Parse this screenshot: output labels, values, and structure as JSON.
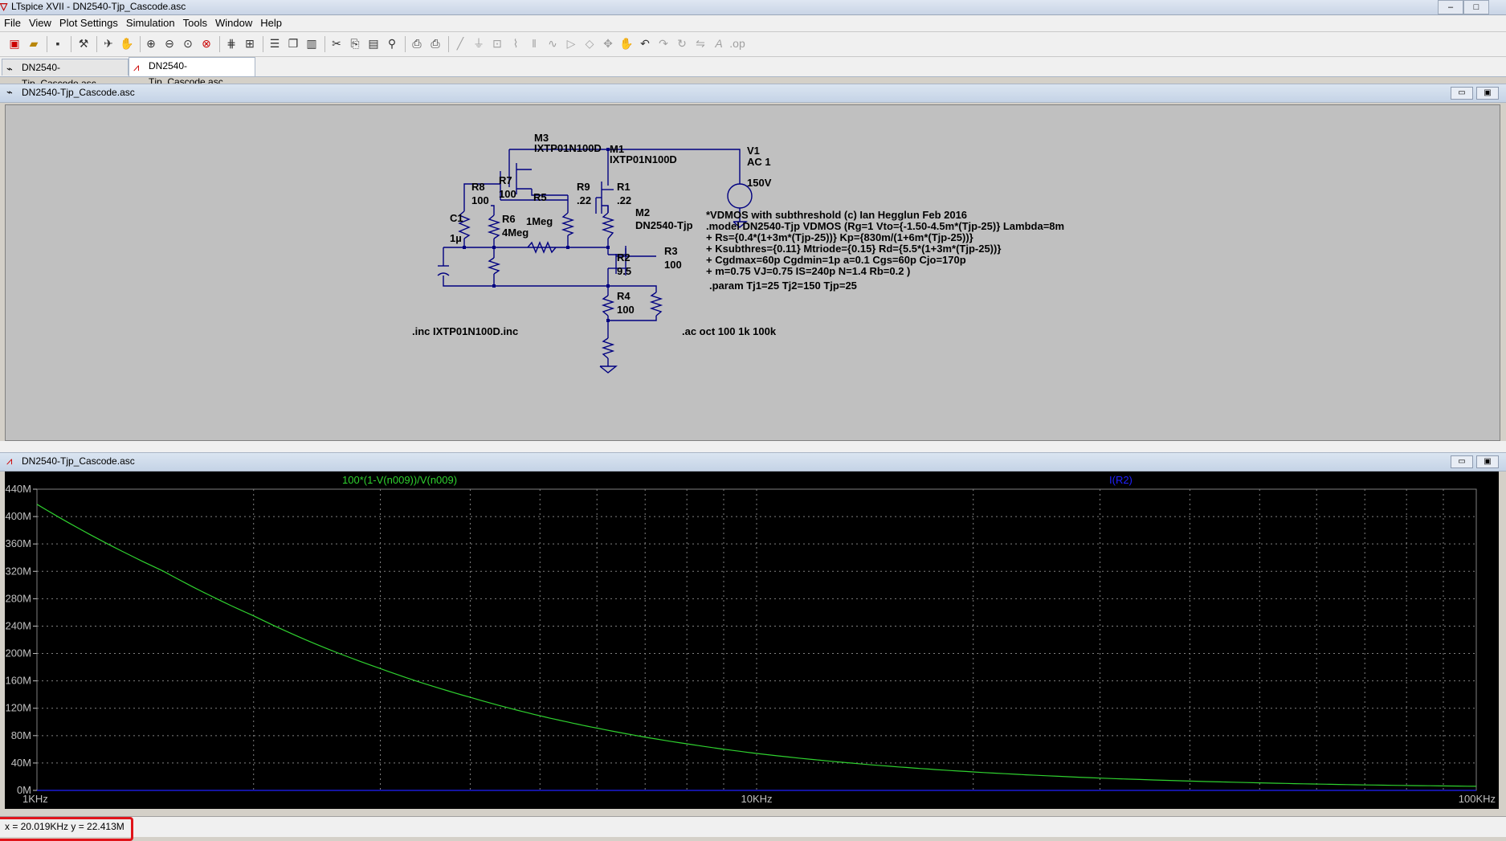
{
  "window": {
    "title": "LTspice XVII - DN2540-Tjp_Cascode.asc"
  },
  "menu": [
    {
      "label": "File",
      "key": "F"
    },
    {
      "label": "View",
      "key": "V"
    },
    {
      "label": "Plot Settings",
      "key": "P"
    },
    {
      "label": "Simulation",
      "key": "S"
    },
    {
      "label": "Tools",
      "key": "T"
    },
    {
      "label": "Window",
      "key": "W"
    },
    {
      "label": "Help",
      "key": "H"
    }
  ],
  "toolbar": {
    "icons": [
      "new-schematic-icon",
      "open-icon",
      "save-icon",
      "control-panel-icon",
      "run-icon",
      "halt-icon",
      "zoom-in-icon",
      "zoom-out-icon",
      "zoom-fit-icon",
      "zoom-cancel-icon",
      "autorange-icon",
      "grid-icon",
      "tile-horizontal-icon",
      "cascade-icon",
      "tile-vertical-icon",
      "cut-icon",
      "copy-icon",
      "paste-icon",
      "find-icon",
      "print-preview-icon",
      "print-icon",
      "wire-icon",
      "ground-icon",
      "label-icon",
      "resistor-icon",
      "capacitor-icon",
      "inductor-icon",
      "diode-icon",
      "component-icon",
      "move-icon",
      "drag-icon",
      "undo-icon",
      "redo-icon",
      "rotate-icon",
      "mirror-icon",
      "text-icon",
      "spice-directive-icon"
    ]
  },
  "tabs": [
    {
      "label": "DN2540-Tjp_Cascode.asc",
      "icon": "schematic-icon",
      "active": false
    },
    {
      "label": "DN2540-Tjp_Cascode.asc",
      "icon": "waveform-icon",
      "active": true
    }
  ],
  "schematic_window": {
    "title": "DN2540-Tjp_Cascode.asc",
    "min_label": "▭",
    "max_label": "▣"
  },
  "plot_window": {
    "title": "DN2540-Tjp_Cascode.asc",
    "min_label": "▭",
    "max_label": "▣"
  },
  "schematic": {
    "components": {
      "M3": {
        "name": "M3",
        "value": "IXTP01N100D"
      },
      "M1": {
        "name": "M1",
        "value": "IXTP01N100D"
      },
      "M2": {
        "name": "M2",
        "value": "DN2540-Tjp"
      },
      "V1": {
        "name": "V1",
        "value": "AC 1",
        "dc": "150V"
      },
      "R8": {
        "name": "R8",
        "value": "100"
      },
      "R7": {
        "name": "R7",
        "value": "100"
      },
      "R5": {
        "name": "R5",
        "value": "1Meg"
      },
      "R9": {
        "name": "R9",
        "value": ".22"
      },
      "R1": {
        "name": "R1",
        "value": ".22"
      },
      "C1": {
        "name": "C1",
        "value": "1µ"
      },
      "R6": {
        "name": "R6",
        "value": "4Meg"
      },
      "R2": {
        "name": "R2",
        "value": "9.5"
      },
      "R3": {
        "name": "R3",
        "value": "100"
      },
      "R4": {
        "name": "R4",
        "value": "100"
      }
    },
    "model_lines": [
      "*VDMOS with subthreshold (c) Ian Hegglun Feb 2016",
      ".model DN2540-Tjp VDMOS (Rg=1 Vto={-1.50-4.5m*(Tjp-25)} Lambda=8m",
      "+ Rs={0.4*(1+3m*(Tjp-25))} Kp={830m/(1+6m*(Tjp-25))}",
      "+ Ksubthres={0.11} Mtriode={0.15} Rd={5.5*(1+3m*(Tjp-25))}",
      "+ Cgdmax=60p Cgdmin=1p a=0.1 Cgs=60p Cjo=170p",
      "+ m=0.75 VJ=0.75 IS=240p N=1.4 Rb=0.2 )"
    ],
    "param": ".param Tj1=25 Tj2=150 Tjp=25",
    "inc": ".inc IXTP01N100D.inc",
    "ac": ".ac oct 100 1k 100k"
  },
  "plot": {
    "trace1_label": "100*(1-V(n009))/V(n009)",
    "trace2_label": "I(R2)",
    "trace1_color": "#2fd12f",
    "trace2_color": "#2020ff",
    "yticks": [
      "440M",
      "400M",
      "360M",
      "320M",
      "280M",
      "240M",
      "200M",
      "160M",
      "120M",
      "80M",
      "40M",
      "0M"
    ],
    "xticks": [
      "1KHz",
      "10KHz",
      "100KHz"
    ]
  },
  "chart_data": {
    "type": "line",
    "title": "",
    "xlabel": "",
    "ylabel": "",
    "xscale": "log",
    "xlim": [
      1000,
      100000
    ],
    "ylim": [
      0,
      440
    ],
    "y_unit": "M",
    "grid": true,
    "legend": "top",
    "series": [
      {
        "name": "100*(1-V(n009))/V(n009)",
        "x": [
          1000,
          1500,
          2000,
          3000,
          4000,
          5000,
          6000,
          8000,
          10000,
          15000,
          20000,
          30000,
          50000,
          70000,
          100000
        ],
        "y": [
          418,
          320,
          255,
          178,
          136,
          109,
          91,
          68,
          54,
          36,
          27,
          18,
          11,
          8,
          6
        ]
      },
      {
        "name": "I(R2)",
        "x": [
          1000,
          100000
        ],
        "y": [
          0,
          0
        ]
      }
    ]
  },
  "status": {
    "cursor": "x = 20.019KHz    y = 22.413M"
  }
}
